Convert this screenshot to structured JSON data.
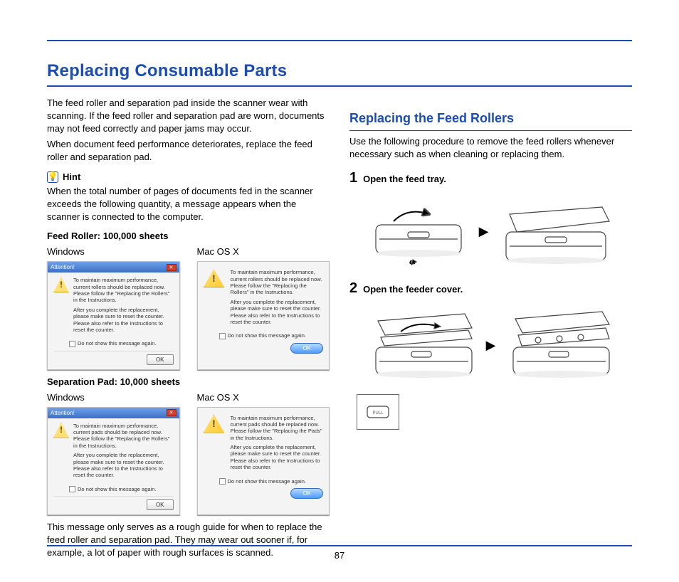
{
  "title": "Replacing Consumable Parts",
  "intro1": "The feed roller and separation pad inside the scanner wear with scanning. If the feed roller and separation pad are worn, documents may not feed correctly and paper jams may occur.",
  "intro2": "When document feed performance deteriorates, replace the feed roller and separation pad.",
  "hint_label": "Hint",
  "hint_text": "When the total number of pages of documents fed in the scanner exceeds the following quantity, a message appears when the scanner is connected to the computer.",
  "section_feed_roller": "Feed Roller: 100,000 sheets",
  "section_sep_pad": "Separation Pad: 10,000 sheets",
  "os_windows": "Windows",
  "os_mac": "Mac OS X",
  "win_dialog_roller": {
    "title": "Attention!",
    "line1": "To maintain maximum performance, current rollers should be replaced now. Please follow the \"Replacing the Rollers\" in the Instructions.",
    "line2": "After you complete the replacement, please make sure to reset the counter. Please also refer to the Instructions to reset the counter.",
    "checkbox": "Do not show this message again.",
    "ok": "OK"
  },
  "mac_dialog_roller": {
    "line1": "To maintain maximum performance, current rollers should be replaced now. Please follow the \"Replacing the Rollers\" in the Instructions.",
    "line2": "After you complete the replacement, please make sure to reset the counter. Please also refer to the Instructions to reset the counter.",
    "checkbox": "Do not show this message again.",
    "ok": "OK"
  },
  "win_dialog_pad": {
    "title": "Attention!",
    "line1": "To maintain maximum performance, current pads should be replaced now. Please follow the \"Replacing the Rollers\" in the Instructions.",
    "line2": "After you complete the replacement, please make sure to reset the counter. Please also refer to the Instructions to reset the counter.",
    "checkbox": "Do not show this message again.",
    "ok": "OK"
  },
  "mac_dialog_pad": {
    "line1": "To maintain maximum performance, current pads should be replaced now. Please follow the \"Replacing the Pads\" in the Instructions.",
    "line2": "After you complete the replacement, please make sure to reset the counter. Please also refer to the Instructions to reset the counter.",
    "checkbox": "Do not show this message again.",
    "ok": "OK"
  },
  "note_after": "This message only serves as a rough guide for when to replace the feed roller and separation pad. They may wear out sooner if, for example, a lot of paper with rough surfaces is scanned.",
  "right_title": "Replacing the Feed Rollers",
  "right_intro": "Use the following procedure to remove the feed rollers whenever necessary such as when cleaning or replacing them.",
  "step1_num": "1",
  "step1_text": "Open the feed tray.",
  "step2_num": "2",
  "step2_text": "Open the feeder cover.",
  "inset_label": "PULL",
  "page_number": "87"
}
